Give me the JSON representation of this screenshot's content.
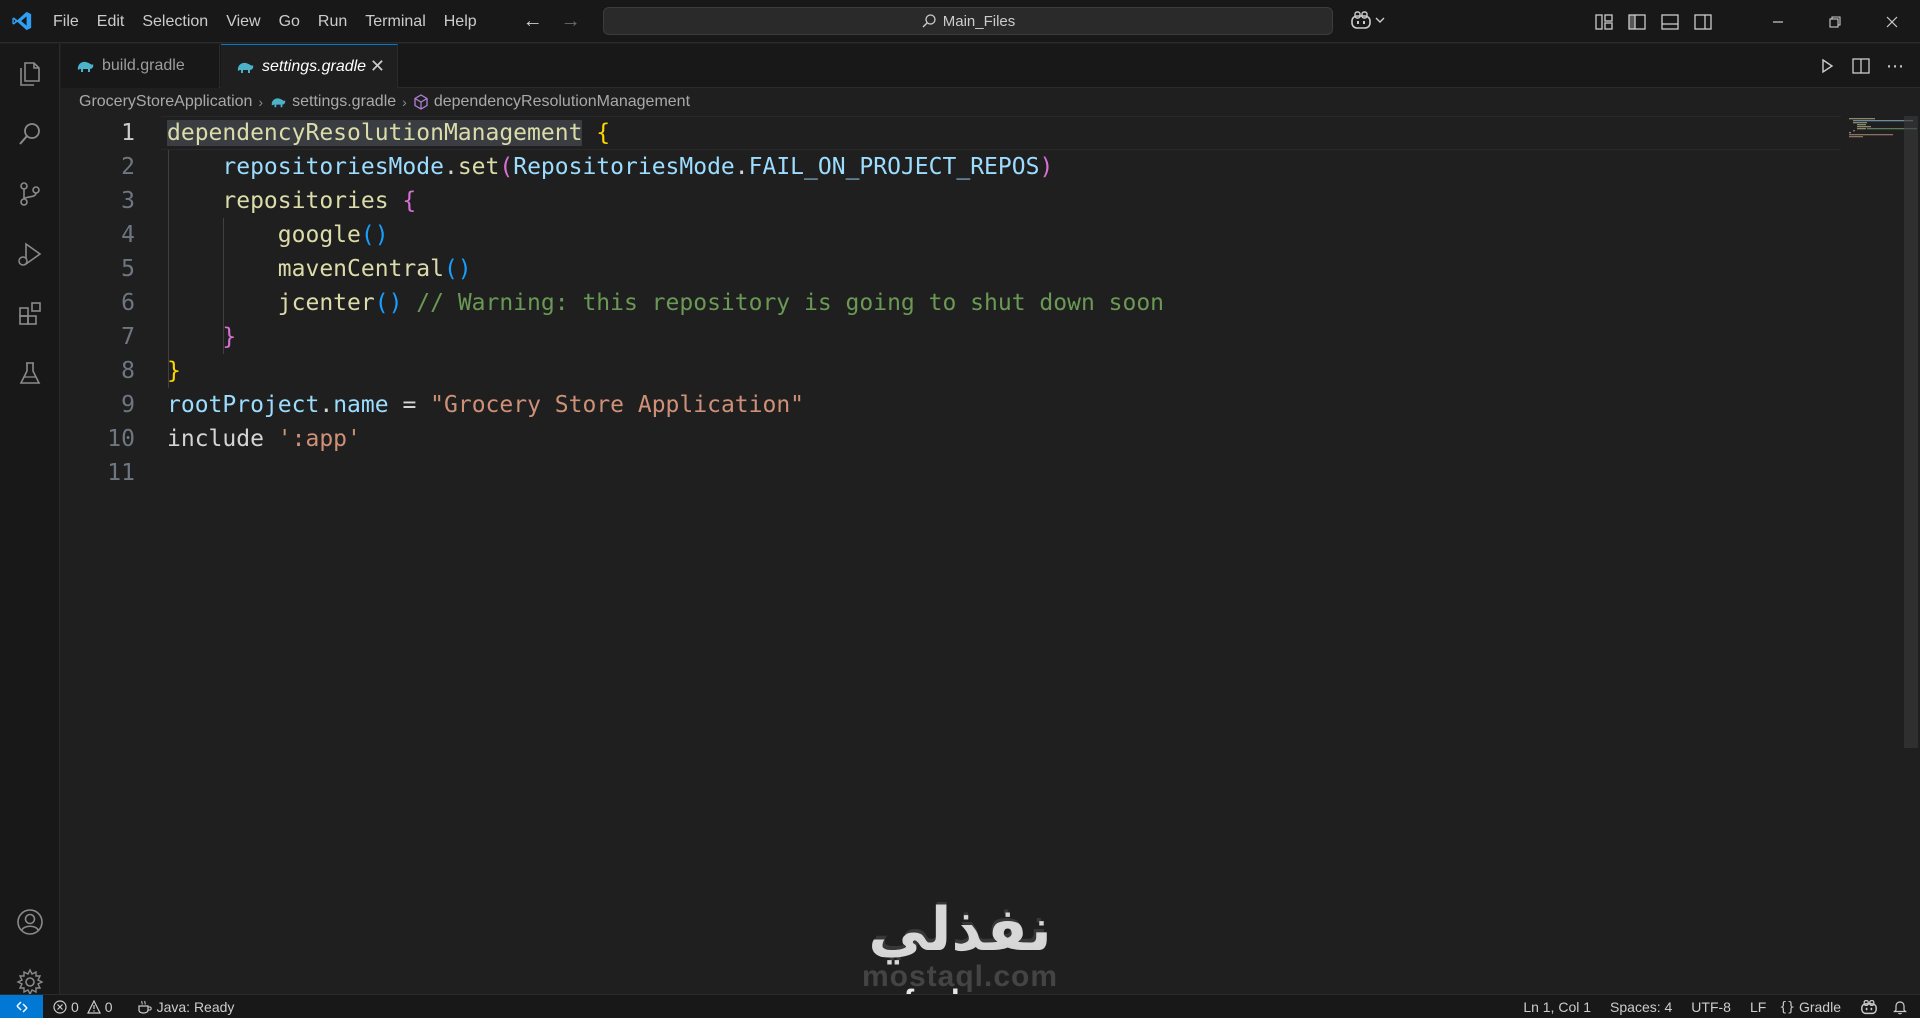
{
  "titlebar": {
    "menu": [
      "File",
      "Edit",
      "Selection",
      "View",
      "Go",
      "Run",
      "Terminal",
      "Help"
    ],
    "search_text": "Main_Files",
    "window_buttons": [
      "minimize",
      "restore",
      "close"
    ]
  },
  "activity_bar": [
    "explorer",
    "search",
    "source-control",
    "run-and-debug",
    "extensions",
    "testing",
    "accounts",
    "manage"
  ],
  "tabs": [
    {
      "label": "build.gradle",
      "active": false
    },
    {
      "label": "settings.gradle",
      "active": true
    }
  ],
  "breadcrumb": [
    "GroceryStoreApplication",
    "settings.gradle",
    "dependencyResolutionManagement"
  ],
  "editor": {
    "language": "gradle",
    "current_line": 1,
    "lines": [
      {
        "num": "1",
        "text": "dependencyResolutionManagement {"
      },
      {
        "num": "2",
        "text": "    repositoriesMode.set(RepositoriesMode.FAIL_ON_PROJECT_REPOS)"
      },
      {
        "num": "3",
        "text": "    repositories {"
      },
      {
        "num": "4",
        "text": "        google()"
      },
      {
        "num": "5",
        "text": "        mavenCentral()"
      },
      {
        "num": "6",
        "text": "        jcenter() // Warning: this repository is going to shut down soon"
      },
      {
        "num": "7",
        "text": "    }"
      },
      {
        "num": "8",
        "text": "}"
      },
      {
        "num": "9",
        "text": "rootProject.name = \"Grocery Store Application\""
      },
      {
        "num": "10",
        "text": "include ':app'"
      },
      {
        "num": "11",
        "text": ""
      }
    ]
  },
  "watermark": {
    "arabic": "نفذلي",
    "mostaql": "mostaql.com",
    "nafezly": "nafezly.com"
  },
  "statusbar": {
    "errors": "0",
    "warnings": "0",
    "java_status": "Java: Ready",
    "position": "Ln 1, Col 1",
    "spaces": "Spaces: 4",
    "encoding": "UTF-8",
    "eol": "LF",
    "language": "Gradle"
  },
  "colors": {
    "accent": "#0078d4",
    "editor_bg": "#1f1f1f",
    "chrome_bg": "#181818"
  }
}
